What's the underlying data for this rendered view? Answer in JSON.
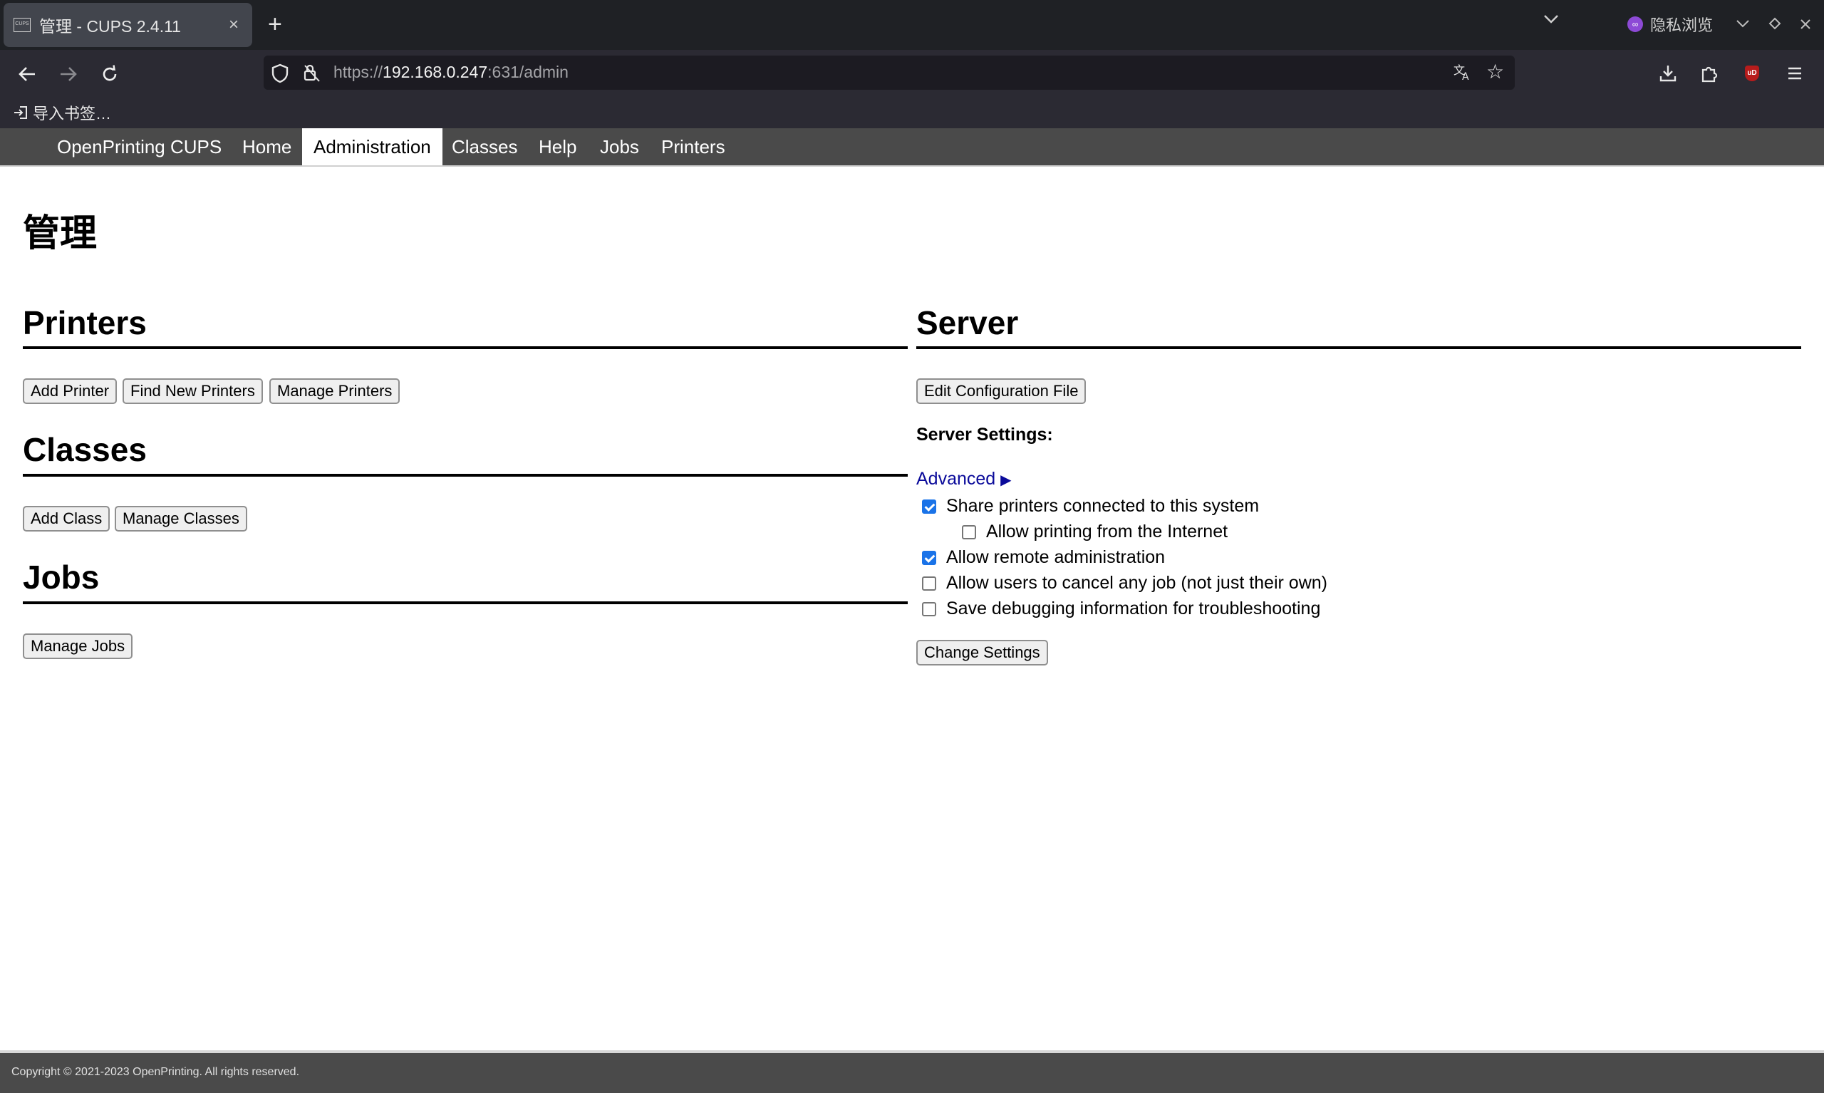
{
  "browser": {
    "tab_title": "管理 - CUPS 2.4.11",
    "tab_favicon_text": "CUPS",
    "url_scheme": "https://",
    "url_host": "192.168.0.247",
    "url_rest": ":631/admin",
    "private_label": "隐私浏览",
    "bookmark_label": "导入书签…",
    "addon_badge": "uD"
  },
  "cups_nav": {
    "brand": "OpenPrinting CUPS",
    "items": [
      "Home",
      "Administration",
      "Classes",
      "Help",
      "Jobs",
      "Printers"
    ],
    "active": "Administration"
  },
  "page": {
    "title": "管理",
    "printers": {
      "heading": "Printers",
      "buttons": [
        "Add Printer",
        "Find New Printers",
        "Manage Printers"
      ]
    },
    "classes": {
      "heading": "Classes",
      "buttons": [
        "Add Class",
        "Manage Classes"
      ]
    },
    "jobs": {
      "heading": "Jobs",
      "buttons": [
        "Manage Jobs"
      ]
    },
    "server": {
      "heading": "Server",
      "edit_button": "Edit Configuration File",
      "settings_label": "Server Settings:",
      "advanced_label": "Advanced",
      "advanced_arrow": "▶",
      "options": [
        {
          "label": "Share printers connected to this system",
          "checked": true
        },
        {
          "label": "Allow printing from the Internet",
          "checked": false
        },
        {
          "label": "Allow remote administration",
          "checked": true
        },
        {
          "label": "Allow users to cancel any job (not just their own)",
          "checked": false
        },
        {
          "label": "Save debugging information for troubleshooting",
          "checked": false
        }
      ],
      "change_button": "Change Settings"
    }
  },
  "footer": {
    "copyright": "Copyright © 2021-2023 OpenPrinting. All rights reserved."
  },
  "colors": {
    "chrome_dark": "#1f2125",
    "toolbar": "#2b2a33",
    "cups_header": "#4a4a4a",
    "link": "#0a0a9a",
    "checkbox": "#1a73e8"
  }
}
